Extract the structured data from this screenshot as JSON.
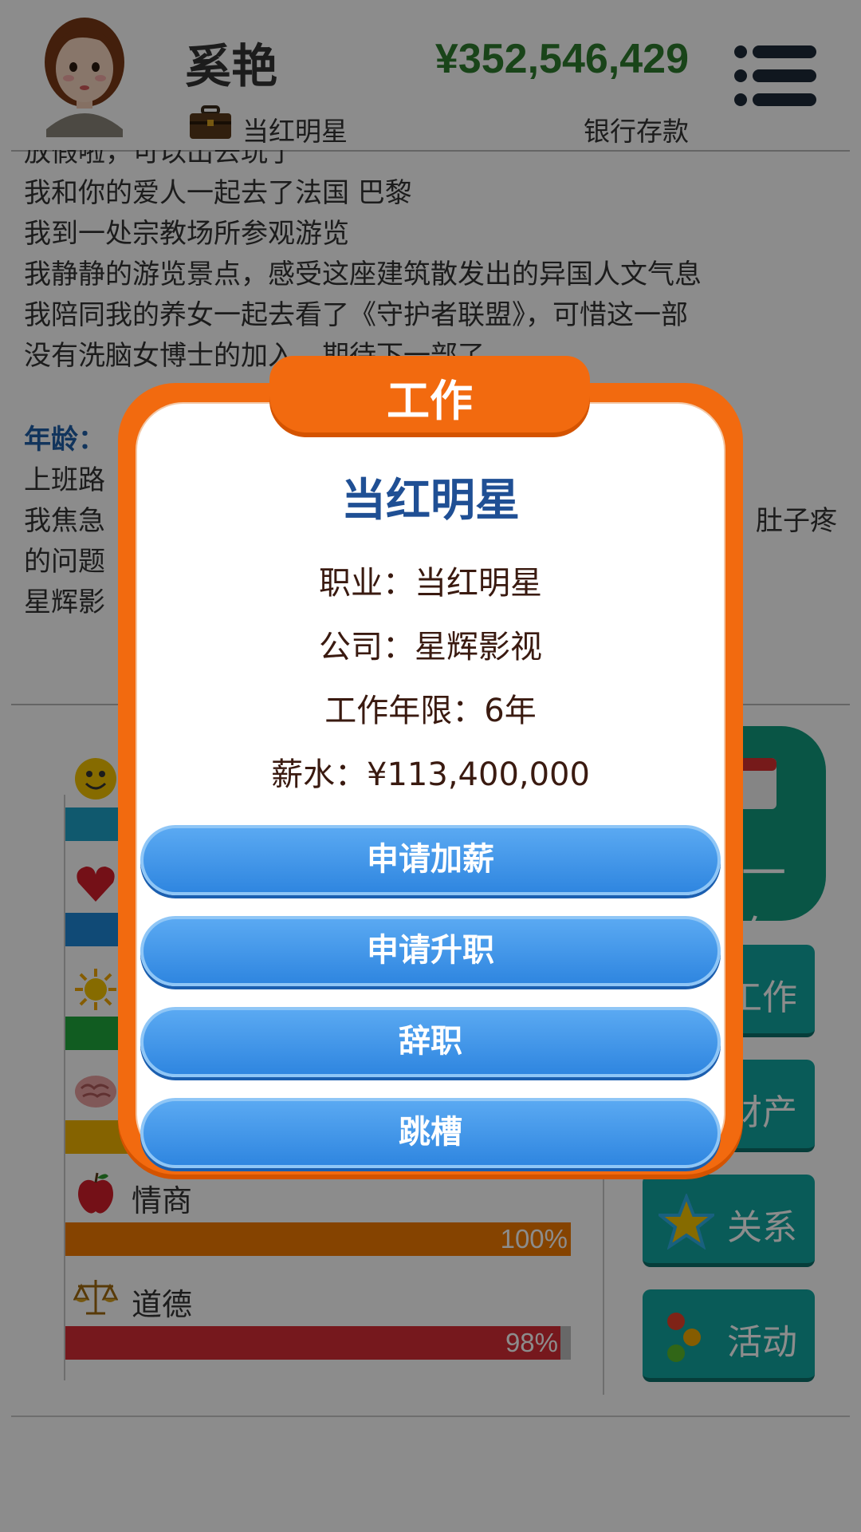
{
  "header": {
    "name": "奚艳",
    "job": "当红明星",
    "money": "¥352,546,429",
    "money_label": "银行存款"
  },
  "log": {
    "lines": [
      "放假啦，可以出去玩了",
      "我和你的爱人一起去了法国 巴黎",
      "我到一处宗教场所参观游览",
      "我静静的游览景点，感受这座建筑散发出的异国人文气息",
      "我陪同我的养女一起去看了《守护者联盟》，可惜这一部",
      "没有洗脑女博士的加入，期待下一部了"
    ],
    "age_label": "年龄：",
    "lines2": [
      "上班路",
      "我焦急",
      "的问题",
      "星辉影"
    ],
    "line2_tail": "肚子疼"
  },
  "stats": [
    {
      "name": "happiness",
      "label": "",
      "value": 100,
      "color": "#1ea2c9",
      "icon": "smiley-icon"
    },
    {
      "name": "health",
      "label": "",
      "value": 100,
      "color": "#1e88d8",
      "icon": "heart-icon"
    },
    {
      "name": "looks",
      "label": "",
      "value": 100,
      "color": "#1fa83c",
      "icon": "sun-icon"
    },
    {
      "name": "intelligence",
      "label": "",
      "value": 100,
      "color": "#f2b400",
      "icon": "brain-icon"
    },
    {
      "name": "eq",
      "label": "情商",
      "value": 100,
      "pct": "100%",
      "color": "#f27a00",
      "icon": "apple-icon"
    },
    {
      "name": "morality",
      "label": "道德",
      "value": 98,
      "pct": "98%",
      "color": "#d82c36",
      "icon": "scales-icon"
    }
  ],
  "side": {
    "year_button": "一年",
    "work": "工作",
    "assets": "财产",
    "relations": "关系",
    "activities": "活动"
  },
  "modal": {
    "title": "工作",
    "job_title": "当红明星",
    "occupation": "职业：当红明星",
    "company": "公司：星辉影视",
    "years": "工作年限：6年",
    "salary": "薪水：¥113,400,000",
    "buttons": {
      "raise": "申请加薪",
      "promotion": "申请升职",
      "resign": "辞职",
      "switch": "跳槽"
    }
  }
}
